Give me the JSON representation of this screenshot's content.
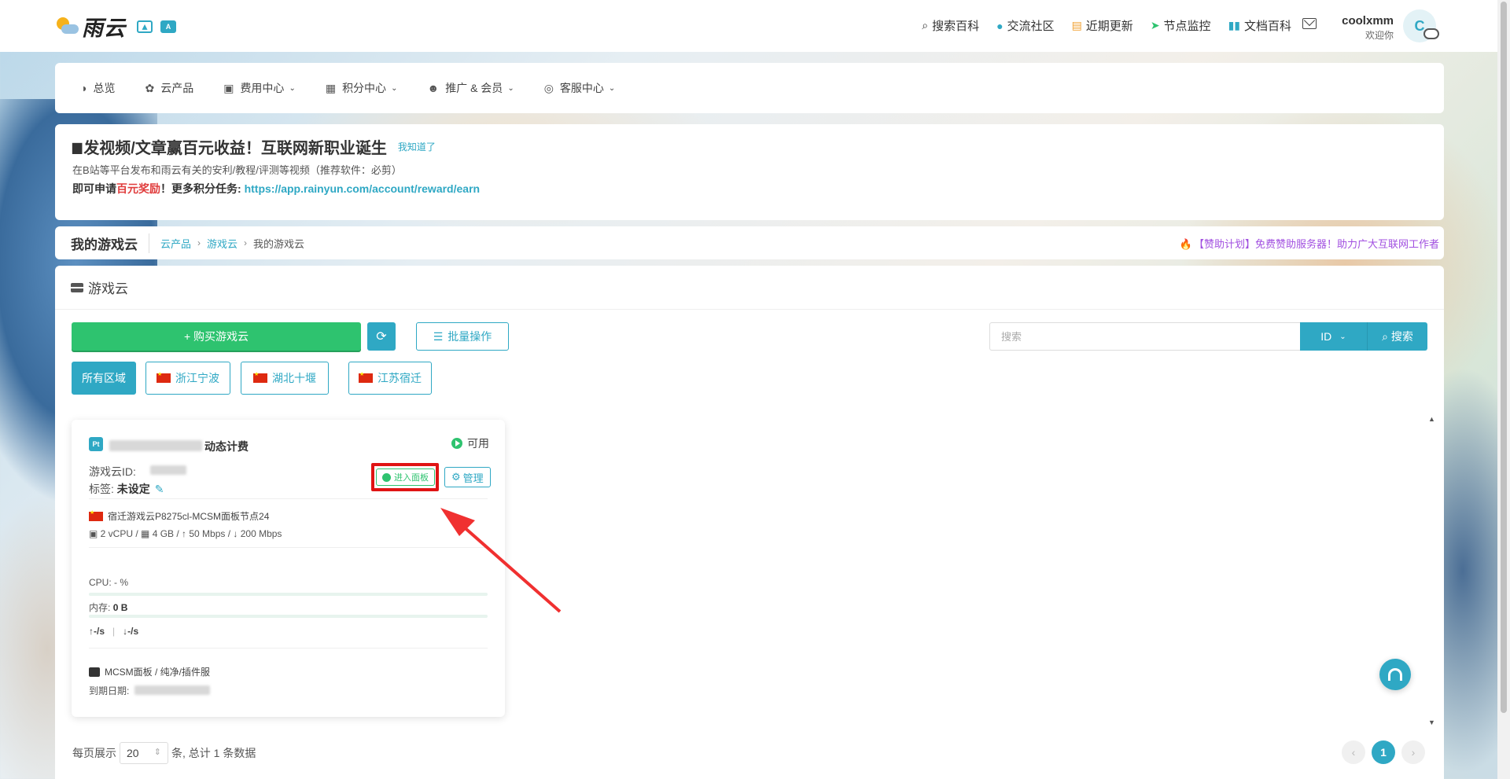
{
  "brand": {
    "name": "雨云"
  },
  "topnav": [
    {
      "label": "搜索百科",
      "glyph": "⌕",
      "icon": "search-icon",
      "color": "#333333"
    },
    {
      "label": "交流社区",
      "glyph": "●",
      "icon": "qq-icon",
      "color": "#2fa8c4"
    },
    {
      "label": "近期更新",
      "glyph": "▤",
      "icon": "news-icon",
      "color": "#f0a030"
    },
    {
      "label": "节点监控",
      "glyph": "➤",
      "icon": "send-icon",
      "color": "#2ec36f"
    },
    {
      "label": "文档百科",
      "glyph": "▮▮",
      "icon": "book-icon",
      "color": "#2fa8c4"
    }
  ],
  "user": {
    "name": "coolxmm",
    "greeting": "欢迎你",
    "avatar_letter": "C"
  },
  "mainnav": [
    {
      "label": "总览",
      "glyph": "◑",
      "icon": "dashboard-icon",
      "dropdown": false
    },
    {
      "label": "云产品",
      "glyph": "✿",
      "icon": "cubes-icon",
      "dropdown": false
    },
    {
      "label": "费用中心",
      "glyph": "▣",
      "icon": "money-icon",
      "dropdown": true
    },
    {
      "label": "积分中心",
      "glyph": "▦",
      "icon": "gift-icon",
      "dropdown": true
    },
    {
      "label": "推广 & 会员",
      "glyph": "☻",
      "icon": "users-icon",
      "dropdown": true
    },
    {
      "label": "客服中心",
      "glyph": "◎",
      "icon": "headset-icon",
      "dropdown": true
    }
  ],
  "announce": {
    "title": "发视频/文章赢百元收益！互联网新职业诞生",
    "dismiss": "我知道了",
    "line1": "在B站等平台发布和雨云有关的安利/教程/评测等视频（推荐软件：必剪）",
    "line2_a": "即可申请",
    "line2_red": "百元奖励",
    "line2_b": "！更多积分任务: ",
    "line2_link": "https://app.rainyun.com/account/reward/earn"
  },
  "breadcrumb": {
    "page_title": "我的游戏云",
    "items": [
      "云产品",
      "游戏云"
    ],
    "current": "我的游戏云",
    "promo": "【赞助计划】免费赞助服务器！助力广大互联网工作者"
  },
  "panel": {
    "title": "游戏云",
    "buy_label": "+ 购买游戏云",
    "batch_label": "批量操作",
    "search_placeholder": "搜索",
    "id_select": "ID",
    "search_label": "搜索",
    "regions": [
      {
        "label": "所有区域",
        "flag": false,
        "active": true
      },
      {
        "label": "浙江宁波",
        "flag": true,
        "active": false
      },
      {
        "label": "湖北十堰",
        "flag": true,
        "active": false
      },
      {
        "label": "江苏宿迁",
        "flag": true,
        "active": false
      }
    ]
  },
  "instance": {
    "name_suffix": "动态计费",
    "status": "可用",
    "id_label": "游戏云ID:",
    "tag_label": "标签:",
    "tag_value": "未设定",
    "enter_label": "进入面板",
    "manage_label": "管理",
    "node": "宿迁游戏云P8275cl-MCSM面板节点24",
    "spec": "2 vCPU / ▦ 4 GB / ↑ 50 Mbps / ↓ 200 Mbps",
    "cpu_label": "CPU:",
    "cpu_value": "- %",
    "mem_label": "内存:",
    "mem_value": "0 B",
    "net_up": "↑-/s",
    "net_down": "↓-/s",
    "panel_type": "MCSM面板 / 纯净/插件服",
    "expire_label": "到期日期:"
  },
  "pagination": {
    "per_page_label": "每页展示",
    "per_page": "20",
    "total_text": "条, 总计 1 条数据",
    "current_page": "1"
  },
  "colors": {
    "accent": "#2fa8c4",
    "success": "#2ec36f",
    "highlight": "#e01414"
  }
}
